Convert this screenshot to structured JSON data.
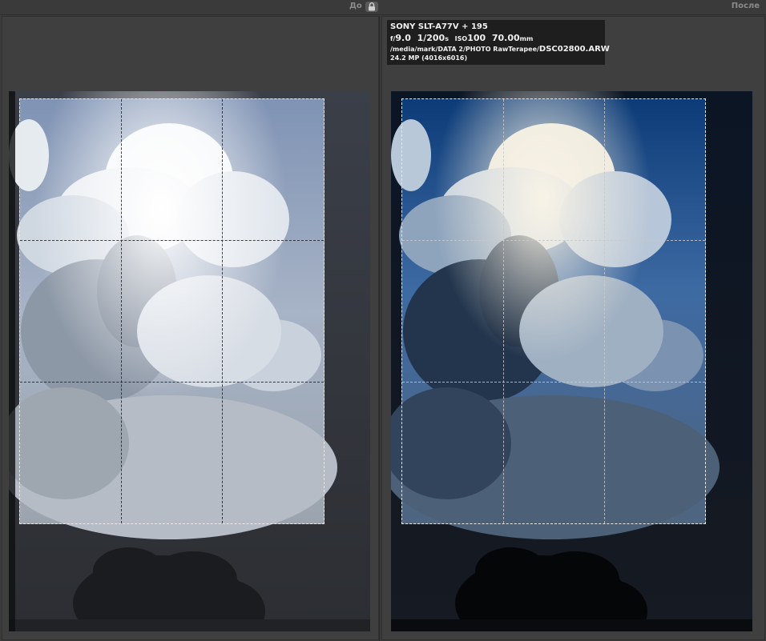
{
  "header": {
    "before_label": "До",
    "after_label": "После",
    "lock_icon": "lock-icon"
  },
  "info": {
    "camera": "SONY SLT-A77V + 195",
    "aperture_prefix": "f/",
    "aperture": "9.0",
    "shutter": "1/200",
    "shutter_unit": "s",
    "iso_label": "ISO",
    "iso": "100",
    "focal": "70.00",
    "focal_unit": "mm",
    "path": "/media/mark/DATA 2/PHOTO RawTerapee/",
    "filename": "DSC02800.ARW",
    "resolution": "24.2 MP (4016x6016)"
  },
  "images": {
    "before": "cloudy-sky-photo-before",
    "after": "cloudy-sky-photo-after"
  },
  "colors": {
    "background": "#3a3a3a",
    "info_background": "#1e1e1e",
    "crop_guide": "#e8e8e8"
  }
}
